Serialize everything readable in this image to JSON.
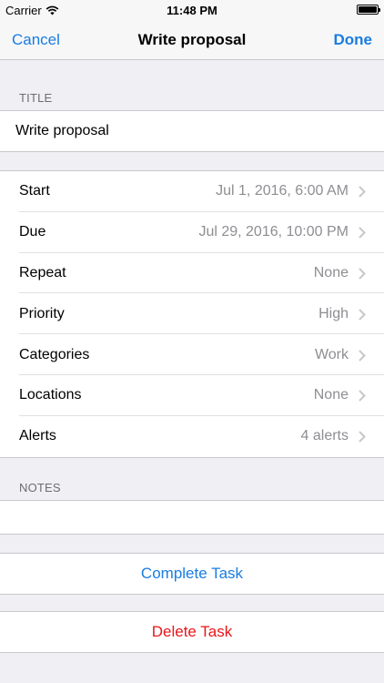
{
  "status_bar": {
    "carrier": "Carrier",
    "time": "11:48 PM"
  },
  "nav": {
    "cancel": "Cancel",
    "title": "Write proposal",
    "done": "Done"
  },
  "title_section": {
    "header": "TITLE",
    "value": "Write proposal"
  },
  "rows": [
    {
      "label": "Start",
      "value": "Jul 1, 2016, 6:00 AM"
    },
    {
      "label": "Due",
      "value": "Jul 29, 2016, 10:00 PM"
    },
    {
      "label": "Repeat",
      "value": "None"
    },
    {
      "label": "Priority",
      "value": "High"
    },
    {
      "label": "Categories",
      "value": "Work"
    },
    {
      "label": "Locations",
      "value": "None"
    },
    {
      "label": "Alerts",
      "value": "4 alerts"
    }
  ],
  "notes_section": {
    "header": "NOTES",
    "value": ""
  },
  "actions": {
    "complete": "Complete Task",
    "delete": "Delete Task"
  },
  "colors": {
    "tint": "#1a7de0",
    "destructive": "#e8161a",
    "background": "#efeff4",
    "value_gray": "#8e8e93"
  }
}
